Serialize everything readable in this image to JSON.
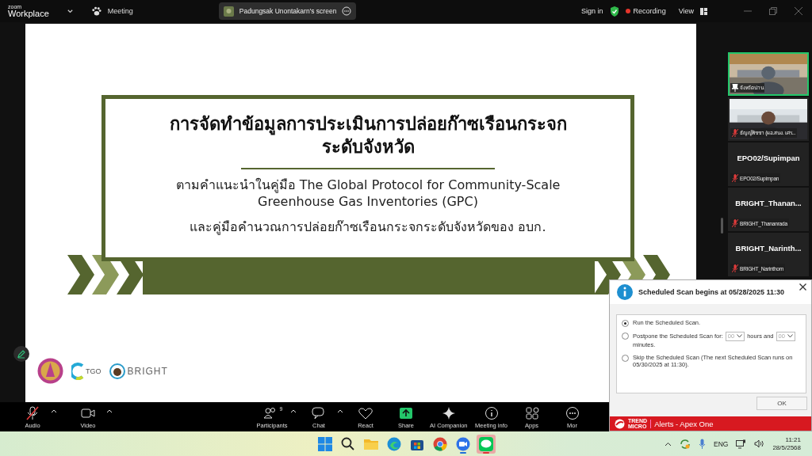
{
  "topbar": {
    "logo_top": "zoom",
    "logo_bottom": "Workplace",
    "meeting_label": "Meeting",
    "share_pill": "Padungsak Unontakarn's screen",
    "sign_in": "Sign in",
    "recording": "Recording",
    "view": "View"
  },
  "slide": {
    "title_lines": [
      "การจัดทำข้อมูลการประเมินการปล่อยก๊าซเรือนกระจก",
      "ระดับจังหวัด"
    ],
    "subtitle_lines": [
      "ตามคำแนะนำในคู่มือ The Global Protocol for Community-Scale",
      "Greenhouse Gas Inventories (GPC)"
    ],
    "note": "และคู่มือคำนวณการปล่อยก๊าซเรือนกระจกระดับจังหวัดของ อบก.",
    "logo_small_text": "TGO",
    "logo_brand": "BRIGHT"
  },
  "participants": [
    {
      "kind": "video",
      "name": "จังหวัดน่าน",
      "active": true,
      "muted": false
    },
    {
      "kind": "video",
      "name": "ธัญญ์พิชชา (ผอ.สนง. เศร...",
      "active": false,
      "muted": true
    },
    {
      "kind": "name",
      "title": "EPO02/Supimpan",
      "name": "EPO02/Supimpan",
      "active": false,
      "muted": true
    },
    {
      "kind": "name",
      "title": "BRIGHT_Thanan...",
      "name": "BRIGHT_Thananrada",
      "active": false,
      "muted": true
    },
    {
      "kind": "name",
      "title": "BRIGHT_Narinth...",
      "name": "BRIGHT_Narinthorn",
      "active": false,
      "muted": true
    }
  ],
  "toolbar": {
    "left": [
      {
        "kind": "audio",
        "label": "Audio",
        "muted": true
      },
      {
        "kind": "video",
        "label": "Video",
        "muted": false
      }
    ],
    "center": [
      {
        "kind": "participants",
        "label": "Participants",
        "count": "9",
        "caret": true
      },
      {
        "kind": "chat",
        "label": "Chat",
        "caret": true
      },
      {
        "kind": "react",
        "label": "React",
        "caret": false
      },
      {
        "kind": "share",
        "label": "Share",
        "caret": false
      },
      {
        "kind": "ai",
        "label": "AI Companion",
        "caret": false
      },
      {
        "kind": "info",
        "label": "Meeting info",
        "caret": false
      },
      {
        "kind": "apps",
        "label": "Apps",
        "caret": false
      },
      {
        "kind": "more",
        "label": "Mor",
        "caret": false
      }
    ]
  },
  "dialog": {
    "title": "Scheduled Scan begins at 05/28/2025 11:30",
    "options": [
      {
        "kind": "plain",
        "label": "Run the Scheduled Scan.",
        "selected": true
      },
      {
        "kind": "postpone",
        "label": "Postpone the Scheduled Scan for:",
        "hours": "00",
        "hours_unit": "hours and",
        "minutes": "00",
        "minutes_unit": "minutes.",
        "selected": false
      },
      {
        "kind": "plain",
        "label": "Skip the Scheduled Scan (The next Scheduled Scan runs on 05/30/2025 at 11:30).",
        "selected": false
      }
    ],
    "ok": "OK",
    "brand_top": "TREND",
    "brand_bottom": "MICRO",
    "footer": "Alerts - Apex One"
  },
  "taskbar": {
    "apps": [
      {
        "kind": "start",
        "running": false,
        "selected": false
      },
      {
        "kind": "search",
        "running": false,
        "selected": false
      },
      {
        "kind": "files",
        "running": false,
        "selected": false
      },
      {
        "kind": "edge",
        "running": false,
        "selected": false
      },
      {
        "kind": "store",
        "running": false,
        "selected": false
      },
      {
        "kind": "chrome",
        "running": false,
        "selected": false
      },
      {
        "kind": "zoom",
        "running": true,
        "selected": false
      },
      {
        "kind": "line",
        "running": true,
        "selected": true
      }
    ],
    "language": "ENG",
    "time": "11:21",
    "date": "28/5/2568"
  }
}
